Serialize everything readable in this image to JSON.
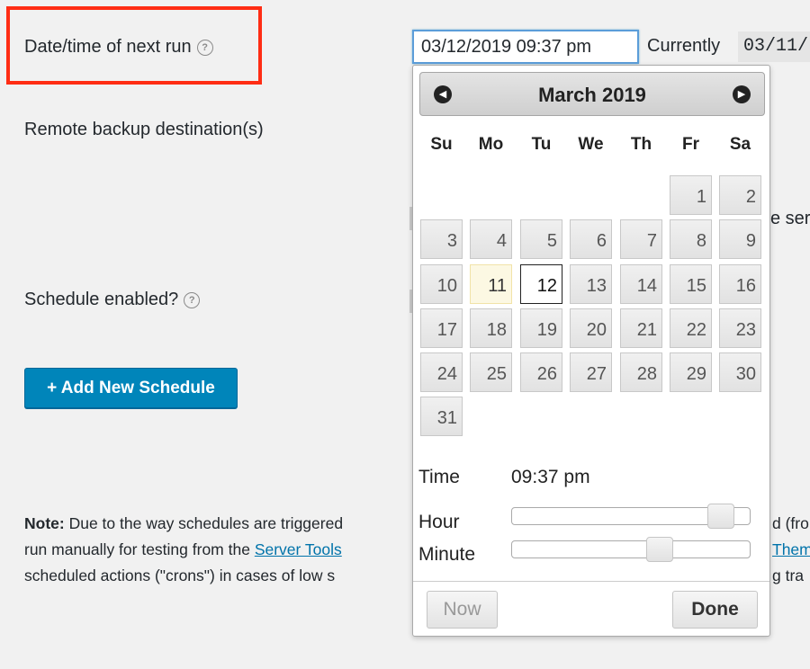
{
  "form": {
    "next_run_label": "Date/time of next run",
    "remote_dest_label": "Remote backup destination(s)",
    "schedule_enabled_label": "Schedule enabled?",
    "help_glyph": "?",
    "next_run_value": "03/12/2019 09:37 pm",
    "currently_label": "Currently",
    "currently_value": "03/11/",
    "add_button_label": "+ Add New Schedule"
  },
  "partial_text": {
    "right_frag_1": "e ser",
    "right_frag_2": "d (fro",
    "right_frag_3": "Them",
    "right_frag_4": "g tra"
  },
  "note": {
    "label": "Note:",
    "line1_text": " Due to the way schedules are triggered",
    "line2_prefix": "run manually for testing from the ",
    "line2_link": "Server Tools",
    "line3_text": "scheduled actions (\"crons\") in cases of low s"
  },
  "datepicker": {
    "month_title": "March 2019",
    "prev_glyph": "◀",
    "next_glyph": "▶",
    "weekdays": [
      "Su",
      "Mo",
      "Tu",
      "We",
      "Th",
      "Fr",
      "Sa"
    ],
    "days": [
      "1",
      "2",
      "3",
      "4",
      "5",
      "6",
      "7",
      "8",
      "9",
      "10",
      "11",
      "12",
      "13",
      "14",
      "15",
      "16",
      "17",
      "18",
      "19",
      "20",
      "21",
      "22",
      "23",
      "24",
      "25",
      "26",
      "27",
      "28",
      "29",
      "30",
      "31"
    ],
    "today": "11",
    "selected": "12",
    "time_label": "Time",
    "time_value": "09:37 pm",
    "hour_label": "Hour",
    "minute_label": "Minute",
    "hour_fraction": 0.92,
    "minute_fraction": 0.63,
    "now_button": "Now",
    "done_button": "Done"
  },
  "colors": {
    "highlight": "#ff2d14",
    "primary_button": "#0085ba",
    "link": "#0073aa"
  }
}
